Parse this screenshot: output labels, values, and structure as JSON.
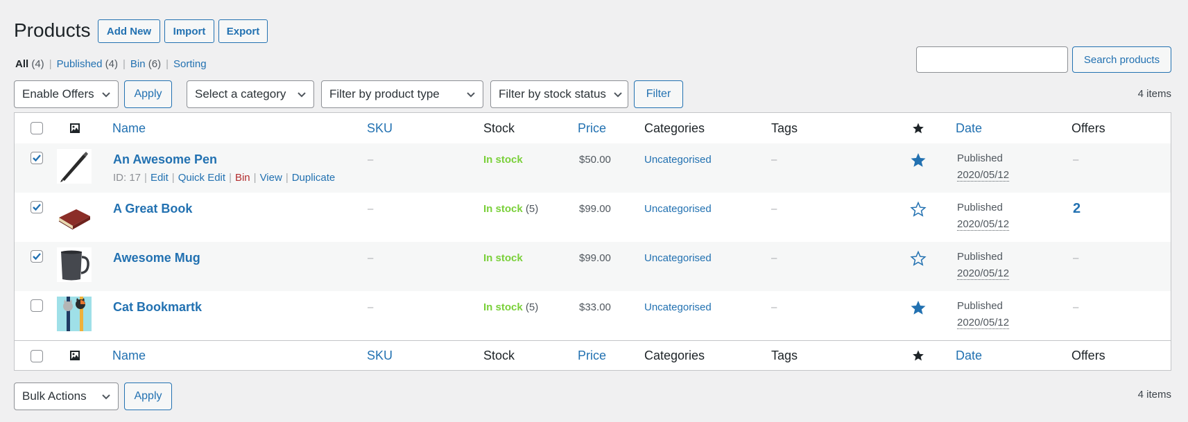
{
  "header": {
    "title": "Products",
    "buttons": [
      "Add New",
      "Import",
      "Export"
    ]
  },
  "views": [
    {
      "label": "All",
      "count": "(4)",
      "current": true
    },
    {
      "label": "Published",
      "count": "(4)",
      "current": false
    },
    {
      "label": "Bin",
      "count": "(6)",
      "current": false
    },
    {
      "label": "Sorting",
      "count": "",
      "current": false
    }
  ],
  "search": {
    "value": "",
    "placeholder": "",
    "button": "Search products"
  },
  "top_actions": {
    "bulk_select": "Enable Offers",
    "apply": "Apply",
    "category_select": "Select a category",
    "type_select": "Filter by product type",
    "stock_select": "Filter by stock status",
    "filter": "Filter",
    "items_count": "4 items"
  },
  "columns": {
    "name": "Name",
    "sku": "SKU",
    "stock": "Stock",
    "price": "Price",
    "categories": "Categories",
    "tags": "Tags",
    "featured_icon": "star-icon",
    "date": "Date",
    "offers": "Offers"
  },
  "rows": [
    {
      "name": "An Awesome Pen",
      "checked": true,
      "thumb": "pen",
      "row_actions": {
        "id": "ID: 17",
        "edit": "Edit",
        "quick_edit": "Quick Edit",
        "bin": "Bin",
        "view": "View",
        "duplicate": "Duplicate"
      },
      "sku": "–",
      "stock": "In stock",
      "stock_count": "",
      "price": "$50.00",
      "category": "Uncategorised",
      "tags": "–",
      "featured": true,
      "status": "Published",
      "date": "2020/05/12",
      "offers": "–"
    },
    {
      "name": "A Great Book",
      "checked": true,
      "thumb": "book",
      "sku": "–",
      "stock": "In stock",
      "stock_count": "(5)",
      "price": "$99.00",
      "category": "Uncategorised",
      "tags": "–",
      "featured": false,
      "status": "Published",
      "date": "2020/05/12",
      "offers": "2"
    },
    {
      "name": "Awesome Mug",
      "checked": true,
      "thumb": "mug",
      "sku": "–",
      "stock": "In stock",
      "stock_count": "",
      "price": "$99.00",
      "category": "Uncategorised",
      "tags": "–",
      "featured": false,
      "status": "Published",
      "date": "2020/05/12",
      "offers": "–"
    },
    {
      "name": "Cat Bookmartk",
      "checked": false,
      "thumb": "bookmark",
      "sku": "–",
      "stock": "In stock",
      "stock_count": "(5)",
      "price": "$33.00",
      "category": "Uncategorised",
      "tags": "–",
      "featured": true,
      "status": "Published",
      "date": "2020/05/12",
      "offers": "–"
    }
  ],
  "bottom_actions": {
    "bulk_select": "Bulk Actions",
    "apply": "Apply",
    "items_count": "4 items"
  },
  "colors": {
    "link": "#2271b1",
    "in_stock": "#7ad03a",
    "delete": "#b32d2e",
    "background": "#f0f0f1"
  }
}
